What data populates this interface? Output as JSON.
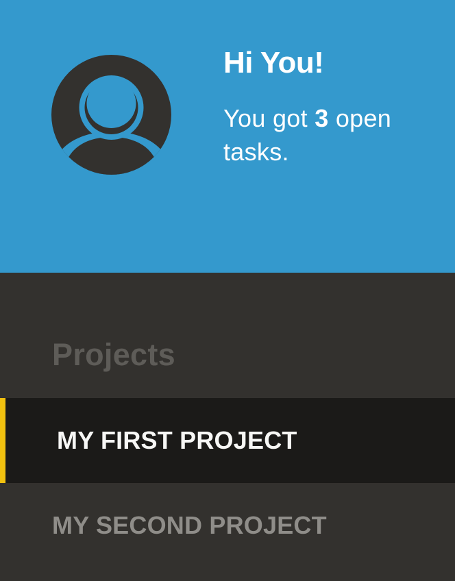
{
  "header": {
    "greeting": "Hi You!",
    "tasks_prefix": "You got ",
    "open_task_count": "3",
    "tasks_suffix": " open tasks.",
    "background_color": "#3499cd"
  },
  "avatar": {
    "icon": "user-avatar-icon"
  },
  "sidebar": {
    "title": "Projects",
    "accent_color": "#f2c10f",
    "projects": [
      {
        "label": "MY FIRST PROJECT",
        "active": true
      },
      {
        "label": "MY SECOND PROJECT",
        "active": false
      }
    ]
  }
}
